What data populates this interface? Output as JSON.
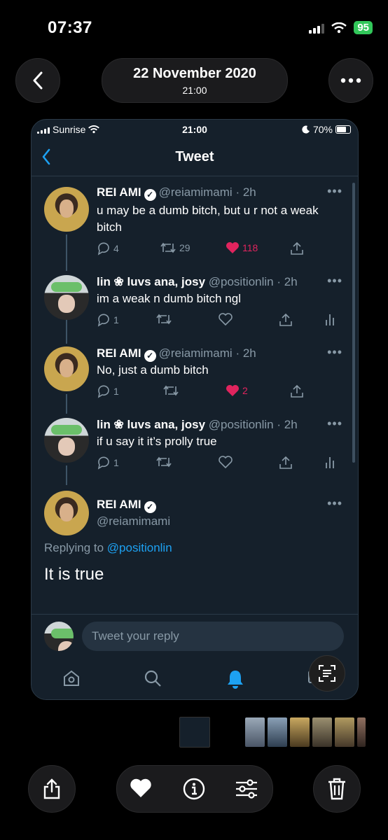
{
  "os_status": {
    "time": "07:37",
    "battery": "95"
  },
  "header": {
    "date": "22 November 2020",
    "time": "21:00"
  },
  "inner_status": {
    "carrier": "Sunrise",
    "time": "21:00",
    "battery": "70%"
  },
  "nav": {
    "title": "Tweet"
  },
  "tweets": [
    {
      "name": "REI AMI",
      "handle": "@reiamimami",
      "time": "· 2h",
      "text": "u may be a dumb bitch, but u r not a weak bitch",
      "replies": "4",
      "retweets": "29",
      "likes": "118",
      "liked": true
    },
    {
      "name": "lin ❀ luvs ana, josy",
      "handle": "@positionlin",
      "time": "· 2h",
      "text": "im a weak n dumb bitch ngl",
      "replies": "1",
      "retweets": "",
      "likes": "",
      "liked": false
    },
    {
      "name": "REI AMI",
      "handle": "@reiamimami",
      "time": "· 2h",
      "text": "No, just a dumb bitch",
      "replies": "1",
      "retweets": "",
      "likes": "2",
      "liked": true
    },
    {
      "name": "lin ❀ luvs ana, josy",
      "handle": "@positionlin",
      "time": "· 2h",
      "text": "if u say it it’s prolly true",
      "replies": "1",
      "retweets": "",
      "likes": "",
      "liked": false
    }
  ],
  "main_tweet": {
    "name": "REI AMI",
    "handle": "@reiamimami",
    "replying_prefix": "Replying to",
    "replying_to": "@positionlin",
    "text": "It is true"
  },
  "reply_box": {
    "placeholder": "Tweet your reply"
  },
  "icons": {
    "back": "chevron-left-icon",
    "more": "ellipsis-icon",
    "share": "share-icon",
    "favorite": "heart-icon",
    "info": "info-icon",
    "adjust": "sliders-icon",
    "delete": "trash-icon",
    "live_text": "text-scan-icon"
  },
  "colors": {
    "twitter_bg": "#15202b",
    "twitter_blue": "#1da1f2",
    "like_red": "#e0245e",
    "battery_green": "#32c75a"
  }
}
